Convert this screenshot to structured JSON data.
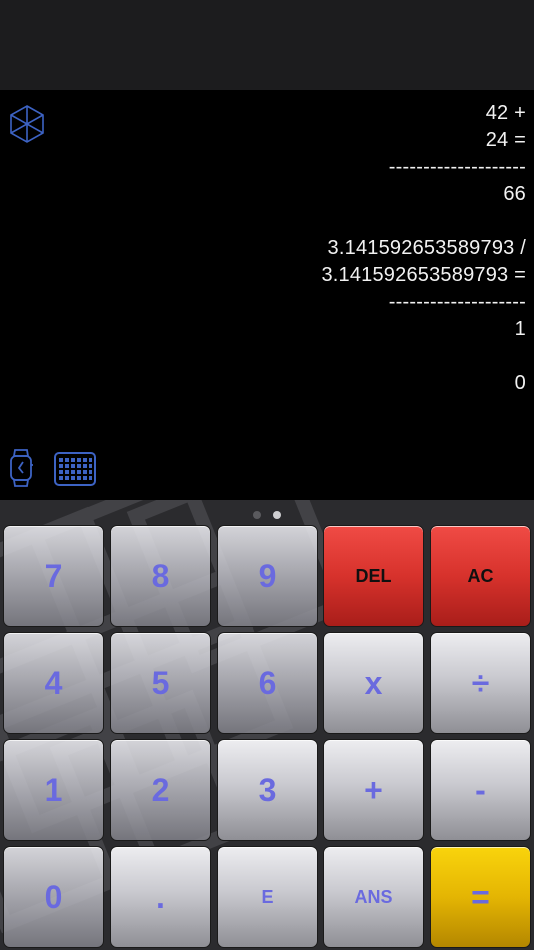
{
  "display": {
    "tape": [
      "42 +",
      "24 =",
      "--------------------",
      "66",
      "",
      "3.141592653589793 /",
      "3.141592653589793 =",
      "--------------------",
      "1",
      "",
      "0"
    ],
    "logo_icon": "cube-logo-icon",
    "watch_icon": "apple-watch-icon",
    "keyboard_icon": "keyboard-grid-icon"
  },
  "pager": {
    "pages": 2,
    "active_page": 2
  },
  "keys": {
    "seven": "7",
    "eight": "8",
    "nine": "9",
    "del": "DEL",
    "ac": "AC",
    "four": "4",
    "five": "5",
    "six": "6",
    "multiply": "x",
    "divide": "÷",
    "one": "1",
    "two": "2",
    "three": "3",
    "plus": "+",
    "minus": "-",
    "zero": "0",
    "decimal": ".",
    "exponent": "E",
    "ans": "ANS",
    "equals": "="
  },
  "colors": {
    "key_text": "#6a6adf",
    "del_ac_key": "#d7322c",
    "equals_key": "#e4b503",
    "icon_blue": "#3d63c4"
  }
}
